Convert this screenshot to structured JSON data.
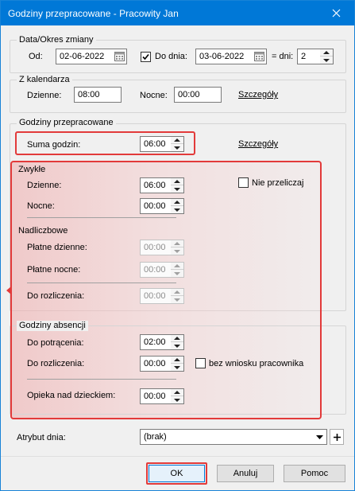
{
  "window": {
    "title": "Godziny przepracowane - Pracowity Jan"
  },
  "data_okres": {
    "title": "Data/Okres zmiany",
    "od_label": "Od:",
    "od_value": "02-06-2022",
    "do_dnia_label": "Do dnia:",
    "do_dnia_checked": true,
    "do_dnia_value": "03-06-2022",
    "dni_label": "= dni:",
    "dni_value": "2"
  },
  "z_kalendarza": {
    "title": "Z kalendarza",
    "dzienne_label": "Dzienne:",
    "dzienne_value": "08:00",
    "nocne_label": "Nocne:",
    "nocne_value": "00:00",
    "szczegoly": "Szczegóły"
  },
  "godziny": {
    "title": "Godziny przepracowane",
    "suma_label": "Suma godzin:",
    "suma_value": "06:00",
    "szczegoly": "Szczegóły",
    "zwykle": {
      "title": "Zwykłe",
      "dzienne_label": "Dzienne:",
      "dzienne_value": "06:00",
      "nocne_label": "Nocne:",
      "nocne_value": "00:00",
      "nie_przeliczaj": "Nie przeliczaj"
    },
    "nadliczbowe": {
      "title": "Nadliczbowe",
      "platne_dzienne_label": "Płatne dzienne:",
      "platne_dzienne_value": "00:00",
      "platne_nocne_label": "Płatne nocne:",
      "platne_nocne_value": "00:00",
      "do_rozliczenia_label": "Do rozliczenia:",
      "do_rozliczenia_value": "00:00"
    }
  },
  "absencji": {
    "title": "Godziny absencji",
    "do_potracenia_label": "Do potrącenia:",
    "do_potracenia_value": "02:00",
    "do_rozliczenia_label": "Do rozliczenia:",
    "do_rozliczenia_value": "00:00",
    "bez_wniosku": "bez wniosku pracownika",
    "opieka_label": "Opieka nad dzieckiem:",
    "opieka_value": "00:00"
  },
  "atrybut": {
    "label": "Atrybut dnia:",
    "value": "(brak)"
  },
  "buttons": {
    "ok": "OK",
    "anuluj": "Anuluj",
    "pomoc": "Pomoc"
  },
  "icons": [
    "close-icon",
    "calendar-icon",
    "spin-up-icon",
    "spin-down-icon",
    "dropdown-arrow-icon",
    "plus-icon",
    "checkmark-icon"
  ],
  "colors": {
    "titlebar": "#0078d7",
    "highlight": "#e23a3a"
  }
}
